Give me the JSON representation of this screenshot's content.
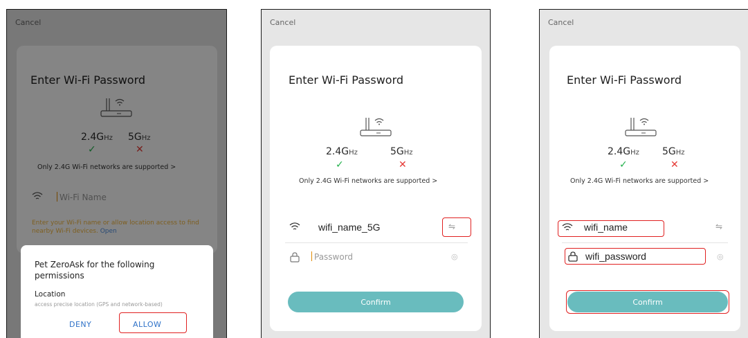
{
  "screens": [
    {
      "cancel": "Cancel",
      "title": "Enter Wi-Fi Password",
      "band_24": "2.4G",
      "band_5": "5G",
      "unit": "Hz",
      "supported_note": "Only 2.4G Wi-Fi networks are supported >",
      "wifi_placeholder": "Wi-Fi Name",
      "location_warning": "Enter your Wi-Fi name or allow location access to find nearby Wi-Fi devices.",
      "warning_link": "Open",
      "dialog": {
        "title": "Pet ZeroAsk for the following permissions",
        "permission_name": "Location",
        "permission_desc": "access precise location (GPS and network-based)",
        "deny": "DENY",
        "allow": "ALLOW"
      }
    },
    {
      "cancel": "Cancel",
      "title": "Enter Wi-Fi Password",
      "band_24": "2.4G",
      "band_5": "5G",
      "unit": "Hz",
      "supported_note": "Only 2.4G Wi-Fi networks are supported >",
      "wifi_name": "wifi_name_5G",
      "password_placeholder": "Password",
      "confirm": "Confirm"
    },
    {
      "cancel": "Cancel",
      "title": "Enter Wi-Fi Password",
      "band_24": "2.4G",
      "band_5": "5G",
      "unit": "Hz",
      "supported_note": "Only 2.4G Wi-Fi networks are supported >",
      "wifi_name": "wifi_name",
      "password": "wifi_password",
      "confirm": "Confirm"
    }
  ],
  "icons": {
    "wifi": "wifi-icon",
    "lock": "lock-icon",
    "switch": "switch-network-icon",
    "eye": "eye-icon",
    "router": "router-icon"
  },
  "colors": {
    "highlight": "#e02020",
    "confirm": "#69bcbe",
    "check": "#22b14c",
    "cross": "#e53935",
    "warning": "#f2b63f",
    "dialog_button": "#2f72c8"
  }
}
